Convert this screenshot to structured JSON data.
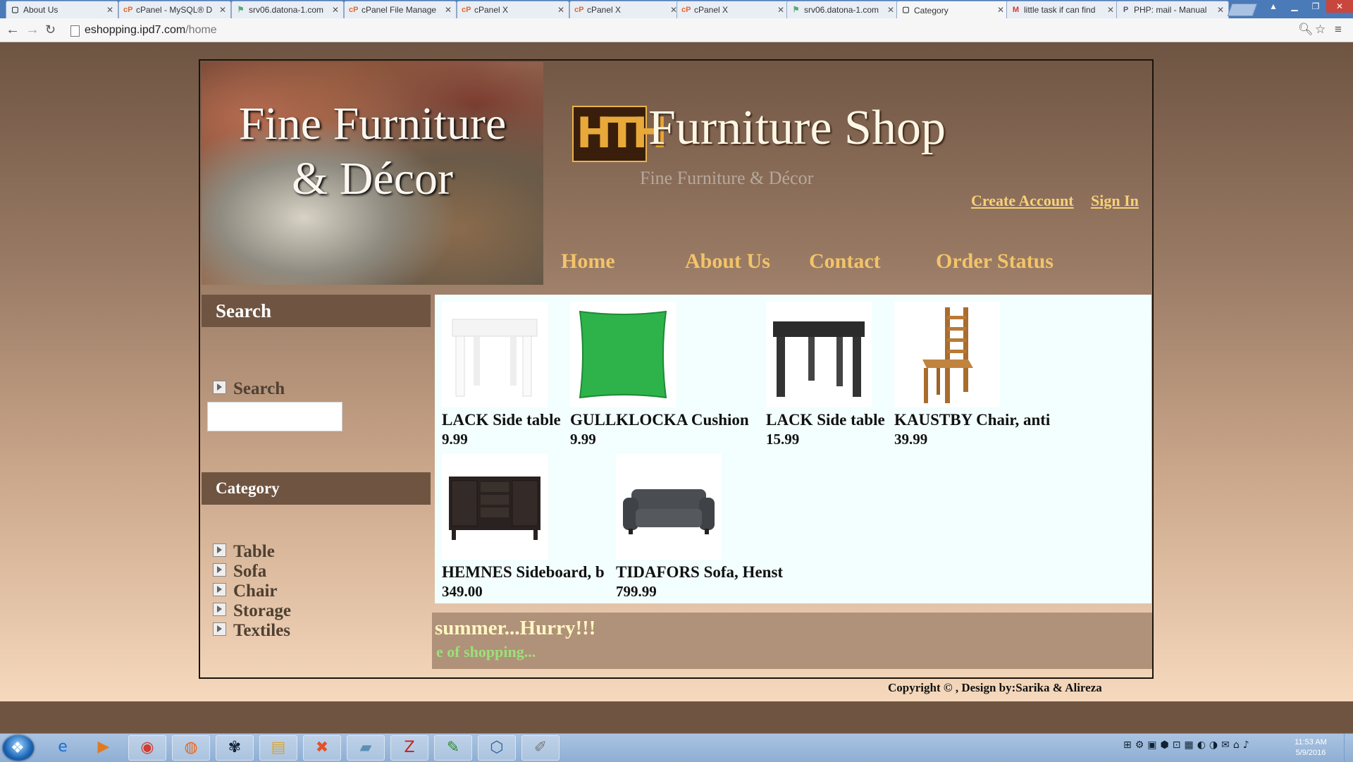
{
  "browser": {
    "tabs": [
      {
        "label": "About Us",
        "icon": "page-icon"
      },
      {
        "label": "cPanel - MySQL® D",
        "icon": "cpanel-icon"
      },
      {
        "label": "srv06.datona-1.com",
        "icon": "phpmyadmin-icon"
      },
      {
        "label": "cPanel File Manage",
        "icon": "cpanel-icon"
      },
      {
        "label": "cPanel X",
        "icon": "cpanel-icon"
      },
      {
        "label": "cPanel X",
        "icon": "cpanel-icon"
      },
      {
        "label": "cPanel X",
        "icon": "cpanel-icon"
      },
      {
        "label": "srv06.datona-1.com",
        "icon": "phpmyadmin-icon"
      },
      {
        "label": "Category",
        "icon": "page-icon",
        "active": true
      },
      {
        "label": "little task if can find",
        "icon": "gmail-icon"
      },
      {
        "label": "PHP: mail - Manual",
        "icon": "php-icon"
      }
    ],
    "url_host": "eshopping.ipd7.com",
    "url_path": "/home"
  },
  "site": {
    "banner_line1": "Fine Furniture",
    "banner_line2": "& Décor",
    "shop_name": "Furniture Shop",
    "tagline": "Fine Furniture & Décor",
    "logo_text": "HTH",
    "top_links": {
      "create_account": "Create Account",
      "sign_in": "Sign In"
    },
    "menu": {
      "home": "Home",
      "about": "About Us",
      "contact": "Contact",
      "order_status": "Order Status"
    }
  },
  "sidebar": {
    "search_title": "Search",
    "search_label": "Search",
    "search_value": "",
    "category_title": "Category",
    "categories": [
      "Table",
      "Sofa",
      "Chair",
      "Storage",
      "Textiles"
    ]
  },
  "products": [
    {
      "name": "LACK Side table",
      "price": "9.99",
      "image": "white-side-table"
    },
    {
      "name": "GULLKLOCKA Cushion",
      "price": "9.99",
      "image": "green-cushion"
    },
    {
      "name": "LACK Side table",
      "price": "15.99",
      "image": "black-side-table"
    },
    {
      "name": "KAUSTBY Chair, anti",
      "price": "39.99",
      "image": "wooden-chair"
    },
    {
      "name": "HEMNES Sideboard, b",
      "price": "349.00",
      "image": "dark-sideboard"
    },
    {
      "name": "TIDAFORS Sofa, Henst",
      "price": "799.99",
      "image": "grey-sofa"
    }
  ],
  "marquee": {
    "line1": "summer...Hurry!!!",
    "line2": "e of shopping..."
  },
  "footer": {
    "copyright": "Copyright © , Design by:Sarika & Alireza"
  },
  "taskbar": {
    "time": "11:53 AM",
    "date": "5/9/2016",
    "apps": [
      "internet-explorer-icon",
      "media-player-icon",
      "chrome-icon",
      "firefox-icon",
      "network-icon",
      "folder-icon",
      "xampp-icon",
      "notepad-icon",
      "filezilla-icon",
      "editor-icon",
      "virtualbox-icon",
      "paint-icon"
    ]
  },
  "colors": {
    "accent_link": "#f7d17a",
    "menu": "#f2c46a",
    "sidebar_header": "#6f5441",
    "content_bg": "#f3fefe"
  }
}
